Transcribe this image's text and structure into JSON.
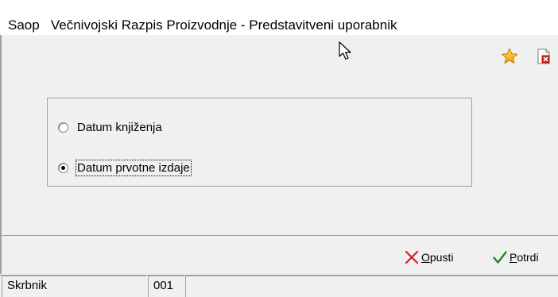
{
  "window": {
    "title": "Saop   Večnivojski Razpis Proizvodnje - Predstavitveni uporabnik"
  },
  "toolbar": {
    "icons": [
      "star-icon",
      "close-document-icon"
    ]
  },
  "options": {
    "items": [
      {
        "label": "Datum knjiženja",
        "checked": false,
        "focused": false
      },
      {
        "label": "Datum prvotne izdaje",
        "checked": true,
        "focused": true
      }
    ]
  },
  "buttons": {
    "cancel_label": "Opusti",
    "cancel_mnemonic": "O",
    "cancel_rest": "pusti",
    "confirm_label": "Potrdi",
    "confirm_mnemonic": "P",
    "confirm_rest": "otrdi"
  },
  "status": {
    "user": "Skrbnik",
    "code": "001",
    "info": ""
  },
  "colors": {
    "cancel_icon": "#d42020",
    "confirm_icon": "#1a8a1a",
    "star": "#f2a900"
  }
}
